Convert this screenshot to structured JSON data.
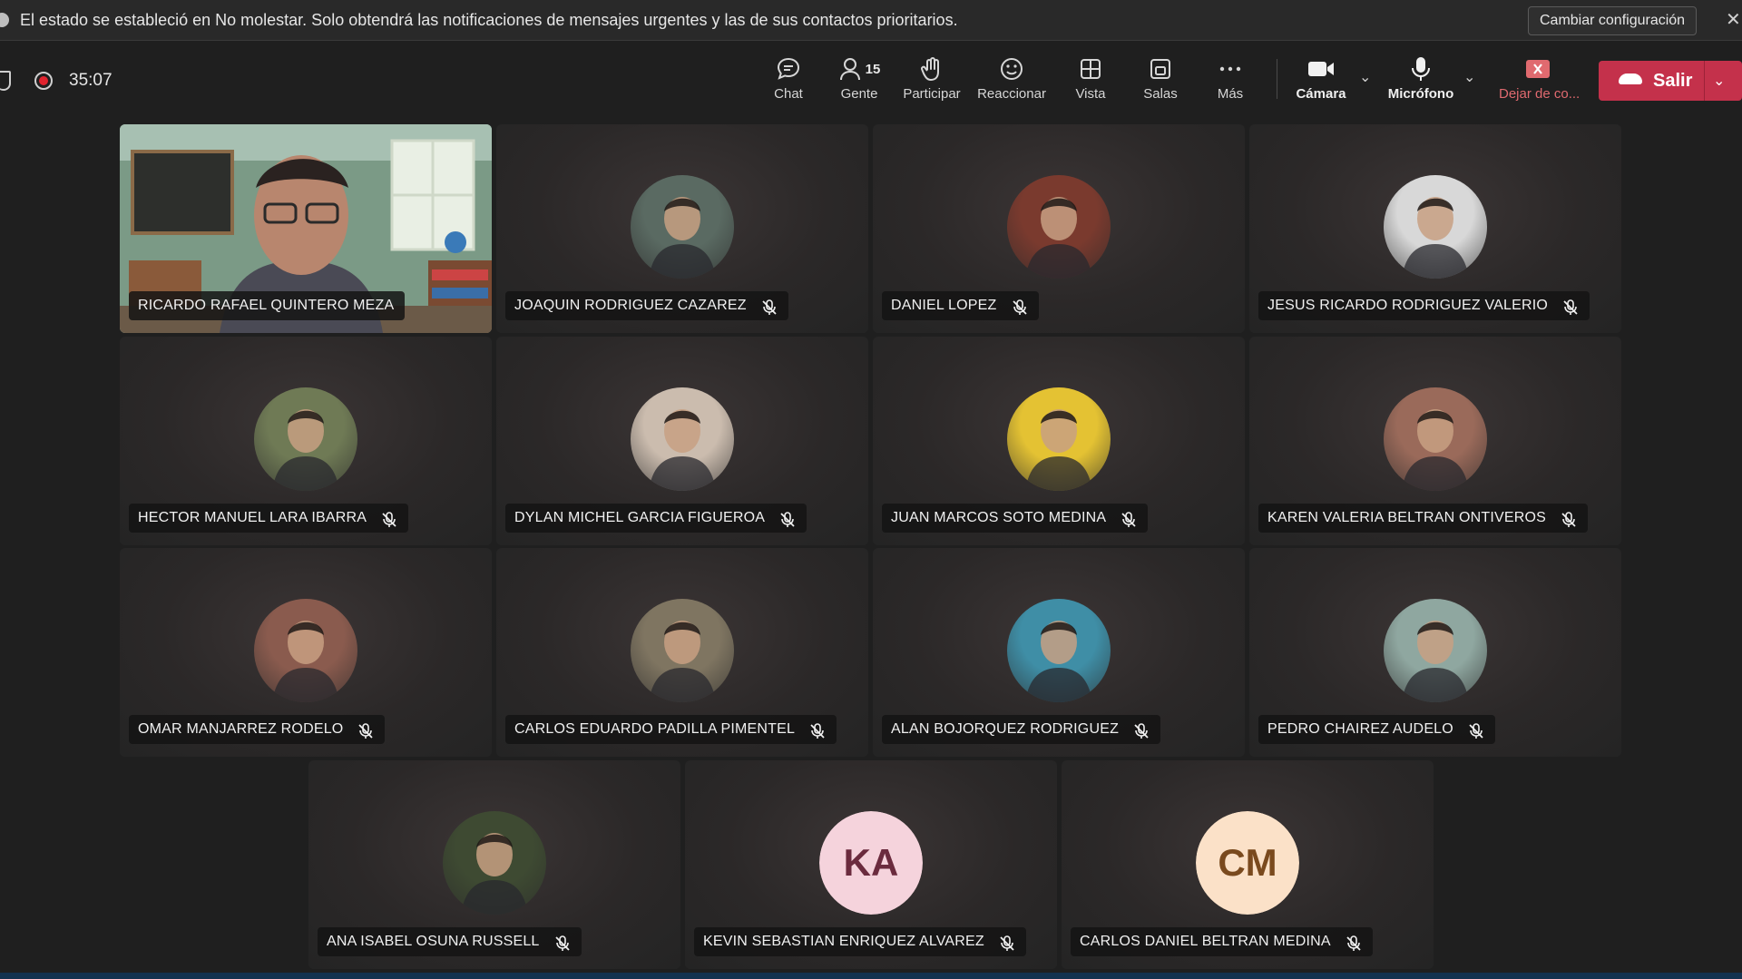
{
  "banner": {
    "message": "El estado se estableció en No molestar. Solo obtendrá las notificaciones de mensajes urgentes y las de sus contactos prioritarios.",
    "button_label": "Cambiar configuración",
    "close_glyph": "✕"
  },
  "toolbar": {
    "timer": "35:07",
    "people_count": "15",
    "items": {
      "chat": "Chat",
      "people": "Gente",
      "raise": "Participar",
      "react": "Reaccionar",
      "view": "Vista",
      "rooms": "Salas",
      "more": "Más",
      "camera": "Cámara",
      "mic": "Micrófono",
      "stop": "Dejar de co..."
    },
    "leave_label": "Salir"
  },
  "participants": [
    {
      "name": "RICARDO RAFAEL QUINTERO MEZA",
      "video": true,
      "muted": false
    },
    {
      "name": "JOAQUIN RODRIGUEZ CAZAREZ",
      "muted": true,
      "avatar_color": "#5a6a62"
    },
    {
      "name": "DANIEL LOPEZ",
      "muted": true,
      "avatar_color": "#7a3a2e"
    },
    {
      "name": "JESUS RICARDO RODRIGUEZ VALERIO",
      "muted": true,
      "avatar_color": "#d8d8d8"
    },
    {
      "name": "HECTOR MANUEL LARA IBARRA",
      "muted": true,
      "avatar_color": "#6f7a55"
    },
    {
      "name": "DYLAN MICHEL GARCIA FIGUEROA",
      "muted": true,
      "avatar_color": "#cbbcae"
    },
    {
      "name": "JUAN MARCOS SOTO MEDINA",
      "muted": true,
      "avatar_color": "#e4c233"
    },
    {
      "name": "KAREN VALERIA BELTRAN ONTIVEROS",
      "muted": true,
      "avatar_color": "#9a6a5a"
    },
    {
      "name": "OMAR MANJARREZ RODELO",
      "muted": true,
      "avatar_color": "#8a5b4e"
    },
    {
      "name": "CARLOS EDUARDO PADILLA PIMENTEL",
      "muted": true,
      "avatar_color": "#7f7561"
    },
    {
      "name": "ALAN BOJORQUEZ RODRIGUEZ",
      "muted": true,
      "avatar_color": "#3f8ea6"
    },
    {
      "name": "PEDRO CHAIREZ AUDELO",
      "muted": true,
      "avatar_color": "#8fa7a0"
    },
    {
      "name": "ANA ISABEL OSUNA RUSSELL",
      "muted": true,
      "avatar_color": "#3e4a32"
    },
    {
      "name": "KEVIN SEBASTIAN ENRIQUEZ ALVAREZ",
      "muted": true,
      "initials": "KA",
      "avatar_color": "#f5d3dc",
      "initials_color": "#6b2b3e"
    },
    {
      "name": "CARLOS DANIEL BELTRAN MEDINA",
      "muted": true,
      "initials": "CM",
      "avatar_color": "#fbe1c8",
      "initials_color": "#7a4a1e"
    }
  ]
}
